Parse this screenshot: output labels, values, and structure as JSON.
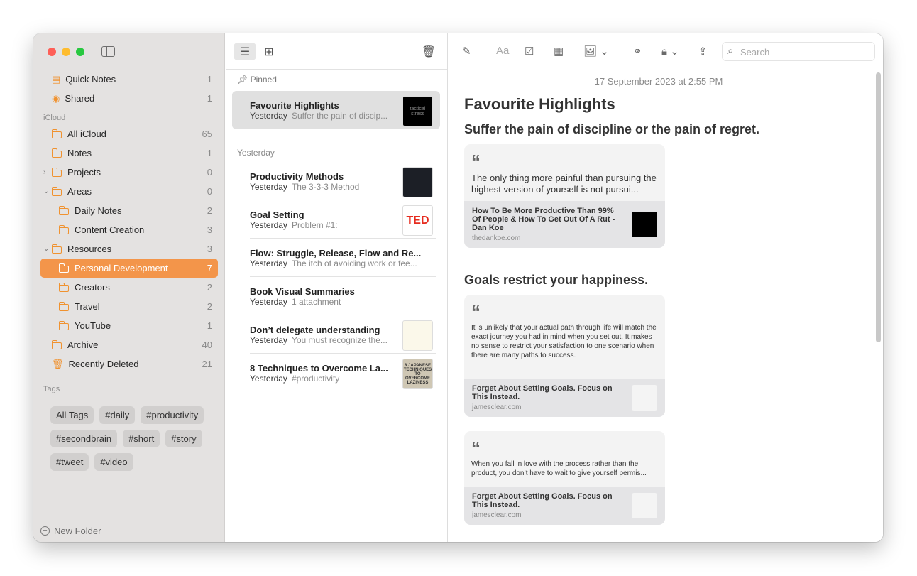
{
  "sidebar": {
    "items": [
      {
        "label": "Quick Notes",
        "count": "1",
        "icon": "quick-notes-icon",
        "indent": 0
      },
      {
        "label": "Shared",
        "count": "1",
        "icon": "shared-icon",
        "indent": 0
      },
      {
        "section": "iCloud"
      },
      {
        "label": "All iCloud",
        "count": "65",
        "icon": "folder-icon",
        "indent": 0
      },
      {
        "label": "Notes",
        "count": "1",
        "icon": "folder-icon",
        "indent": 0
      },
      {
        "label": "Projects",
        "count": "0",
        "icon": "folder-icon",
        "indent": 0,
        "chevron": "›"
      },
      {
        "label": "Areas",
        "count": "0",
        "icon": "folder-icon",
        "indent": 0,
        "chevron": "⌄"
      },
      {
        "label": "Daily Notes",
        "count": "2",
        "icon": "folder-icon",
        "indent": 1
      },
      {
        "label": "Content Creation",
        "count": "3",
        "icon": "folder-icon",
        "indent": 1
      },
      {
        "label": "Resources",
        "count": "3",
        "icon": "folder-icon",
        "indent": 0,
        "chevron": "⌄"
      },
      {
        "label": "Personal Development",
        "count": "7",
        "icon": "folder-icon",
        "indent": 1,
        "selected": true
      },
      {
        "label": "Creators",
        "count": "2",
        "icon": "folder-icon",
        "indent": 1
      },
      {
        "label": "Travel",
        "count": "2",
        "icon": "folder-icon",
        "indent": 1
      },
      {
        "label": "YouTube",
        "count": "1",
        "icon": "folder-icon",
        "indent": 1
      },
      {
        "label": "Archive",
        "count": "40",
        "icon": "folder-icon",
        "indent": 0
      },
      {
        "label": "Recently Deleted",
        "count": "21",
        "icon": "trash-icon",
        "indent": 0
      },
      {
        "section": "Tags"
      }
    ],
    "tags": [
      "All Tags",
      "#daily",
      "#productivity",
      "#secondbrain",
      "#short",
      "#story",
      "#tweet",
      "#video"
    ],
    "new_folder": "New Folder"
  },
  "list": {
    "pinned_label": "Pinned",
    "pinned": [
      {
        "title": "Favourite Highlights",
        "date": "Yesterday",
        "preview": "Suffer the pain of discip...",
        "thumb": "tactical stress",
        "thumb_bg": "#000",
        "thumb_fg": "#888"
      }
    ],
    "section": "Yesterday",
    "notes": [
      {
        "title": "Productivity Methods",
        "date": "Yesterday",
        "preview": "The 3-3-3 Method",
        "thumb": "",
        "thumb_bg": "#1c1f26",
        "thumb_fg": "#aaa"
      },
      {
        "title": "Goal Setting",
        "date": "Yesterday",
        "preview": "Problem #1:",
        "thumb": "TED",
        "thumb_bg": "#fff",
        "thumb_fg": "#e62b1e"
      },
      {
        "title": "Flow: Struggle, Release, Flow and Re...",
        "date": "Yesterday",
        "preview": "The itch of avoiding work or fee..."
      },
      {
        "title": "Book Visual Summaries",
        "date": "Yesterday",
        "preview": "1 attachment"
      },
      {
        "title": "Don’t delegate understanding",
        "date": "Yesterday",
        "preview": "You must recognize the...",
        "thumb": "",
        "thumb_bg": "#fbf8ea",
        "thumb_fg": "#999"
      },
      {
        "title": "8 Techniques to Overcome La...",
        "date": "Yesterday",
        "preview": "#productivity",
        "thumb": "8 JAPANESE TECHNIQUES TO OVERCOME LAZINESS",
        "thumb_bg": "#cfc7b4",
        "thumb_fg": "#333"
      }
    ]
  },
  "editor": {
    "search_placeholder": "Search",
    "format_label": "Aa",
    "date": "17 September 2023 at 2:55 PM",
    "title": "Favourite Highlights",
    "sections": [
      {
        "heading": "Suffer the pain of discipline or the pain of regret.",
        "cards": [
          {
            "quote": "The only thing more painful than pursuing the highest version of yourself is not pursui...",
            "size": "13px",
            "link_title": "How To Be More Productive Than 99% Of People & How To Get Out Of A Rut - Dan Koe",
            "domain": "thedankoe.com",
            "thumb_bg": "#000"
          }
        ]
      },
      {
        "heading": "Goals restrict your happiness.",
        "cards": [
          {
            "quote": "It is unlikely that your actual path through life will match the exact journey you had in mind when you set out. It makes no sense to restrict your satisfaction to one scenario when there are many paths to success.",
            "size": "10px",
            "link_title": "Forget About Setting Goals. Focus on This Instead.",
            "domain": "jamesclear.com",
            "thumb_bg": "#f4f4f4"
          },
          {
            "quote": "When you fall in love with the process rather than the product, you don’t have to wait to give yourself permis...",
            "size": "10px",
            "link_title": "Forget About Setting Goals. Focus on This Instead.",
            "domain": "jamesclear.com",
            "thumb_bg": "#f4f4f4"
          }
        ]
      }
    ]
  },
  "colors": {
    "accent": "#f3954a",
    "folder": "#f0922f",
    "red": "#fe5f57",
    "yellow": "#febc2e",
    "green": "#28c840"
  }
}
